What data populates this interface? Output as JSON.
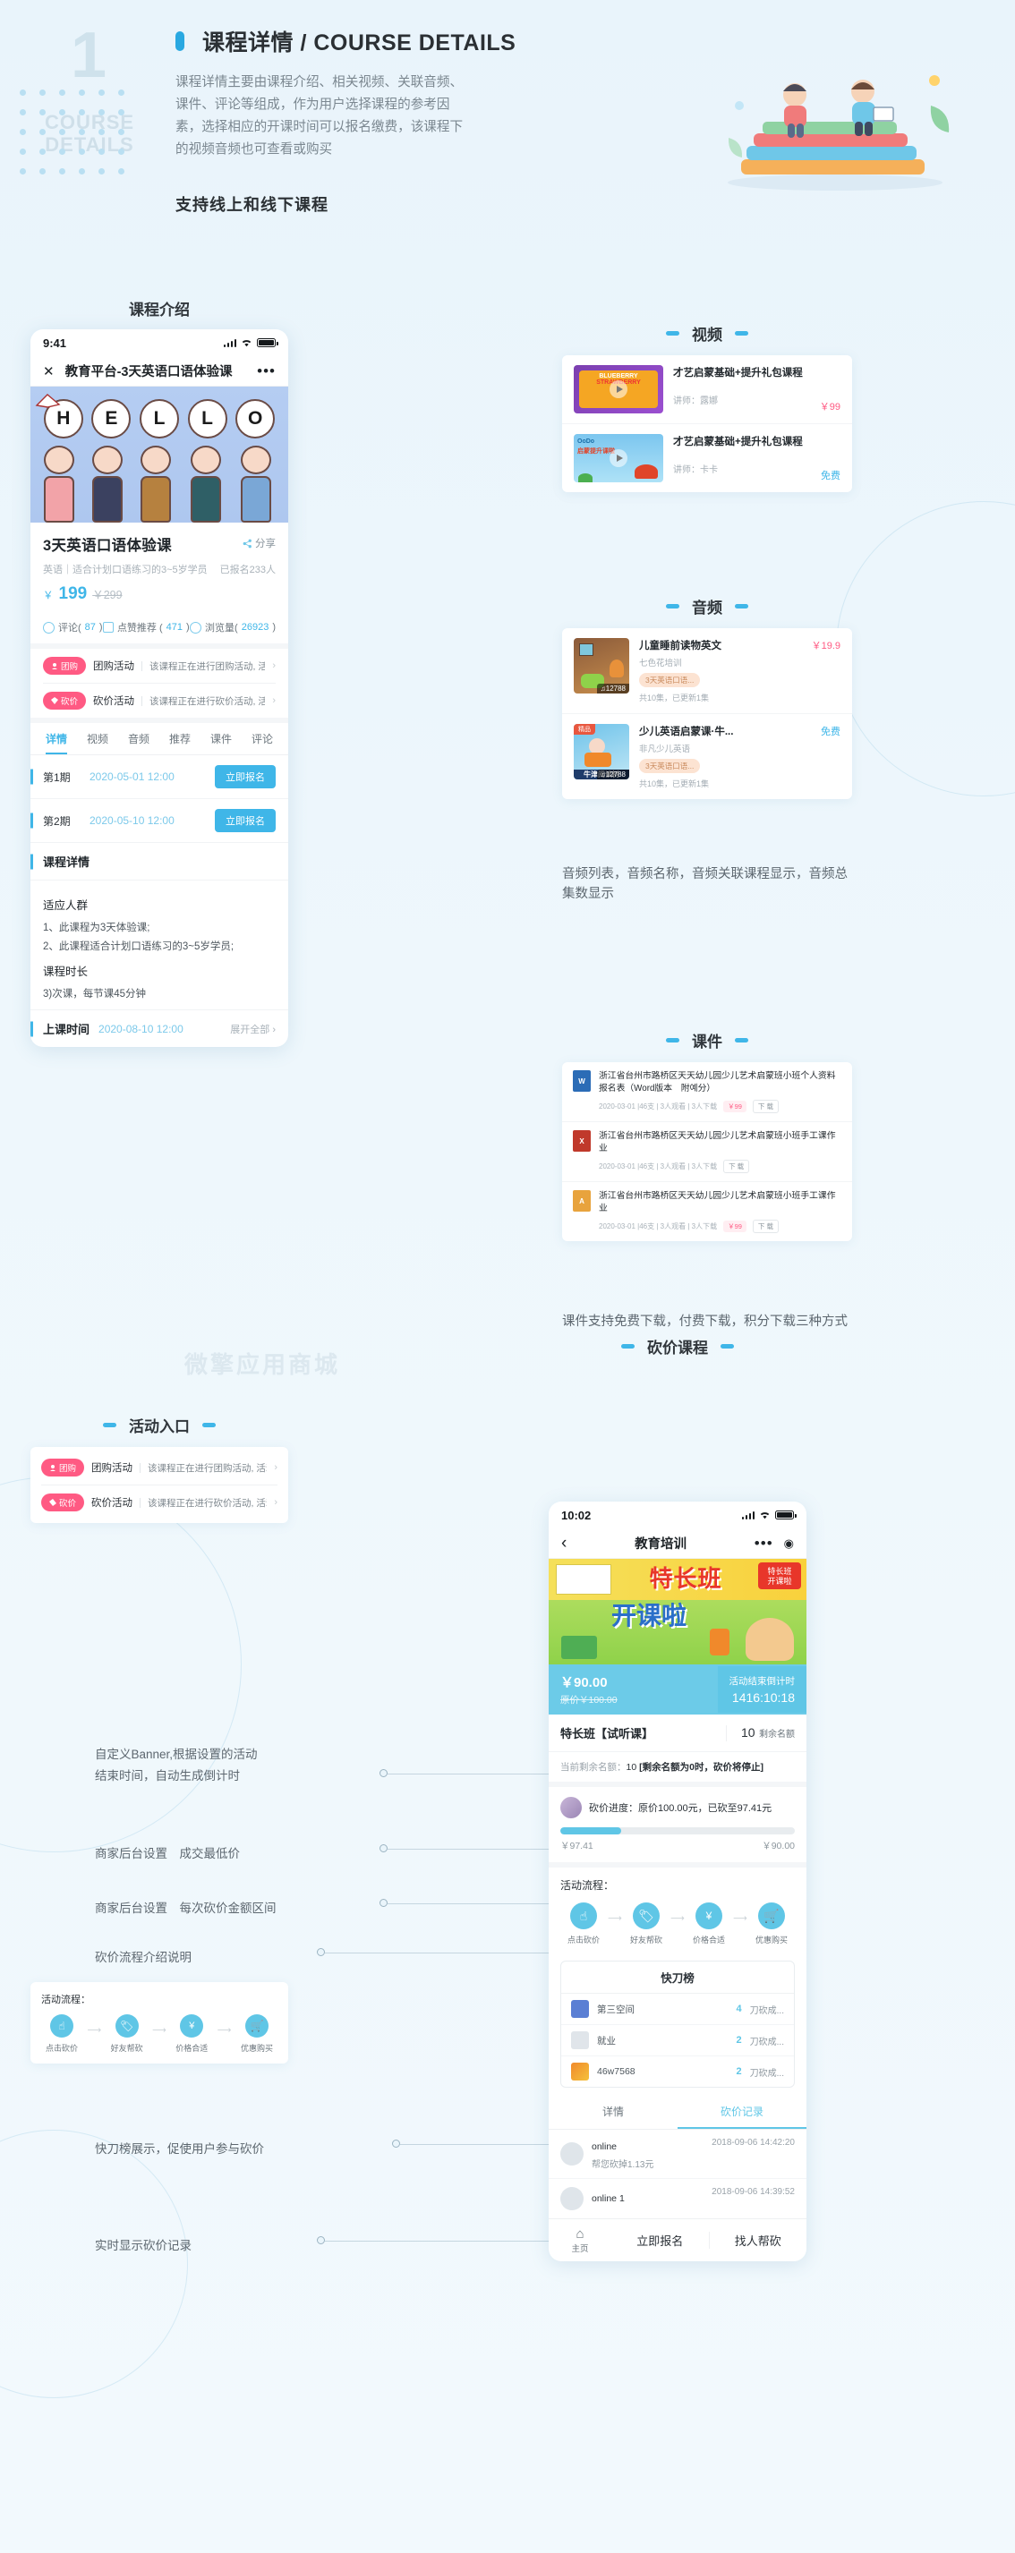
{
  "header": {
    "number": "1",
    "sub_en_line1": "COURSE",
    "sub_en_line2": "DETAILS",
    "title": "课程详情 / COURSE DETAILS",
    "body": "课程详情主要由课程介绍、相关视频、关联音频、课件、评论等组成，作为用户选择课程的参考因素，选择相应的开课时间可以报名缴费，该课程下的视频音频也可查看或购买",
    "strong": "支持线上和线下课程",
    "accent": "#29a8e1"
  },
  "labels": {
    "course_intro": "课程介绍",
    "video": "视频",
    "audio": "音频",
    "courseware": "课件",
    "activity_entry": "活动入口",
    "bargain_course": "砍价课程"
  },
  "captions": {
    "audio": "音频列表，音频名称，音频关联课程显示，音频总集数显示",
    "courseware": "课件支持免费下载，付费下载，积分下载三种方式",
    "banner": "自定义Banner,根据设置的活动",
    "banner2": "结束时间，自动生成倒计时",
    "min_price": "商家后台设置　成交最低价",
    "range_price": "商家后台设置　每次砍价金额区间",
    "flow_intro": "砍价流程介绍说明",
    "rank": "快刀榜展示，促使用户参与砍价",
    "records": "实时显示砍价记录"
  },
  "watermark": "微擎应用商城",
  "phone": {
    "status": {
      "time": "9:41"
    },
    "nav": {
      "close": "✕",
      "title": "教育平台-3天英语口语体验课",
      "more": "•••"
    },
    "hero_letters": [
      "H",
      "E",
      "L",
      "L",
      "O"
    ],
    "course": {
      "title": "3天英语口语体验课",
      "share": "分享",
      "meta_left": "英语｜适合计划口语练习的3~5岁学员",
      "meta_right": "已报名233人",
      "currency": "￥",
      "price": "199",
      "price_old": "￥299",
      "stats": [
        {
          "icon": "comment-icon",
          "label": "评论(",
          "value": "87",
          "tail": ")"
        },
        {
          "icon": "thumbup-icon",
          "label": "点赞推荐 (",
          "value": "471",
          "tail": ")"
        },
        {
          "icon": "eye-icon",
          "label": "浏览量(",
          "value": "26923",
          "tail": ")"
        }
      ]
    },
    "promos": [
      {
        "tag": "团购",
        "name": "团购活动",
        "desc": "该课程正在进行团购活动, 活动仅剩..."
      },
      {
        "tag": "砍价",
        "name": "砍价活动",
        "desc": "该课程正在进行砍价活动, 活动仅剩..."
      }
    ],
    "tabs": [
      "详情",
      "视频",
      "音频",
      "推荐",
      "课件",
      "评论"
    ],
    "active_tab": "详情",
    "terms": [
      {
        "label": "第1期",
        "date": "2020-05-01 12:00",
        "button": "立即报名"
      },
      {
        "label": "第2期",
        "date": "2020-05-10 12:00",
        "button": "立即报名"
      }
    ],
    "detail_head": "课程详情",
    "detail": {
      "audience_title": "适应人群",
      "audience_1": "1、此课程为3天体验课;",
      "audience_2": "2、此课程适合计划口语练习的3~5岁学员;",
      "duration_title": "课程时长",
      "duration_value": "3)次课，每节课45分钟"
    },
    "class_time": {
      "label": "上课时间",
      "date": "2020-08-10 12:00",
      "more": "展开全部 ›"
    }
  },
  "video_card": {
    "items": [
      {
        "title": "才艺启蒙基础+提升礼包课程",
        "teacher": "讲师：露娜",
        "price": "￥99",
        "free": false,
        "thumb": "BLUEBERRY STRAWBERRY"
      },
      {
        "title": "才艺启蒙基础+提升礼包课程",
        "teacher": "讲师：卡卡",
        "price": "免费",
        "free": true,
        "thumb": "OoDo 启蒙提升课啦"
      }
    ]
  },
  "audio_card": {
    "items": [
      {
        "title": "儿童睡前读物英文",
        "org": "七色花培训",
        "pill": "3天英语口语...",
        "eps": "共10集，已更新1集",
        "price": "￥19.9",
        "free": false,
        "count": "12788"
      },
      {
        "title": "少儿英语启蒙课·牛...",
        "org": "非凡少儿英语",
        "pill": "3天英语口语...",
        "eps": "共10集，已更新1集",
        "price": "免费",
        "free": true,
        "count": "12788",
        "badge": "精品"
      }
    ]
  },
  "courseware_card": {
    "items": [
      {
        "type": "W",
        "color": "#2b6cb6",
        "title": "浙江省台州市路桥区天天幼儿园少儿艺术启蒙班小班个人资料报名表（Word版本　附예分）",
        "meta": "2020-03-01 |46支 | 3人观看 | 3人下载",
        "badge": "￥99",
        "btn": "下 载"
      },
      {
        "type": "X",
        "color": "#c0392b",
        "title": "浙江省台州市路桥区天天幼儿园少儿艺术启蒙班小班手工课作业",
        "meta": "2020-03-01 |46支 | 3人观看 | 3人下载",
        "badge": "",
        "btn": "下 载"
      },
      {
        "type": "A",
        "color": "#e8a33d",
        "title": "浙江省台州市路桥区天天幼儿园少儿艺术启蒙班小班手工课作业",
        "meta": "2020-03-01 |46支 | 3人观看 | 3人下载",
        "badge": "￥99",
        "btn": "下 载"
      }
    ]
  },
  "activity_entry": {
    "rows": [
      {
        "tag": "团购",
        "name": "团购活动",
        "desc": "该课程正在进行团购活动, 活动仅剩..."
      },
      {
        "tag": "砍价",
        "name": "砍价活动",
        "desc": "该课程正在进行砍价活动, 活动仅剩..."
      }
    ]
  },
  "flow_mini": {
    "title": "活动流程：",
    "steps": [
      {
        "icon": "tap-icon",
        "label": "点击砍价"
      },
      {
        "icon": "tag-icon",
        "label": "好友帮砍"
      },
      {
        "icon": "ticket-icon",
        "label": "价格合适"
      },
      {
        "icon": "cart-icon",
        "label": "优惠购买"
      }
    ]
  },
  "phone2": {
    "status": {
      "time": "10:02"
    },
    "nav": {
      "back": "‹",
      "title": "教育培训",
      "more": "•••",
      "circle": "◉"
    },
    "banner_text": "特长班 开课啦",
    "price_bar": {
      "now": "￥90.00",
      "old": "原价￥100.00",
      "countdown_label": "活动结束倒计时",
      "countdown": "1416:10:18"
    },
    "title_row": {
      "name": "特长班【试听课】",
      "quota_num": "10",
      "quota_label": "剩余名额"
    },
    "note_prefix": "当前剩余名额：",
    "note_num": "10",
    "note_suffix": "[剩余名额为0时，砍价将停止]",
    "progress": {
      "text": "砍价进度：原价100.00元，已砍至97.41元",
      "percent": 26,
      "left": "￥97.41",
      "right": "￥90.00"
    },
    "flow_title": "活动流程：",
    "flow_steps": [
      {
        "icon": "tap-icon",
        "label": "点击砍价"
      },
      {
        "icon": "tag-icon",
        "label": "好友帮砍"
      },
      {
        "icon": "ticket-icon",
        "label": "价格合适"
      },
      {
        "icon": "cart-icon",
        "label": "优惠购买"
      }
    ],
    "rank_title": "快刀榜",
    "rank_rows": [
      {
        "name": "第三空间",
        "count": "4",
        "suffix": "刀砍成..."
      },
      {
        "name": "就业",
        "count": "2",
        "suffix": "刀砍成..."
      },
      {
        "name": "46w7568",
        "count": "2",
        "suffix": "刀砍成..."
      }
    ],
    "tabs": [
      "详情",
      "砍价记录"
    ],
    "active_tab": "砍价记录",
    "logs": [
      {
        "name": "online",
        "desc": "帮您砍掉1.13元",
        "time": "2018-09-06 14:42:20"
      },
      {
        "name": "online 1",
        "desc": "",
        "time": "2018-09-06 14:39:52"
      }
    ],
    "bottom": {
      "home": "主页",
      "enroll": "立即报名",
      "help": "找人帮砍"
    }
  }
}
